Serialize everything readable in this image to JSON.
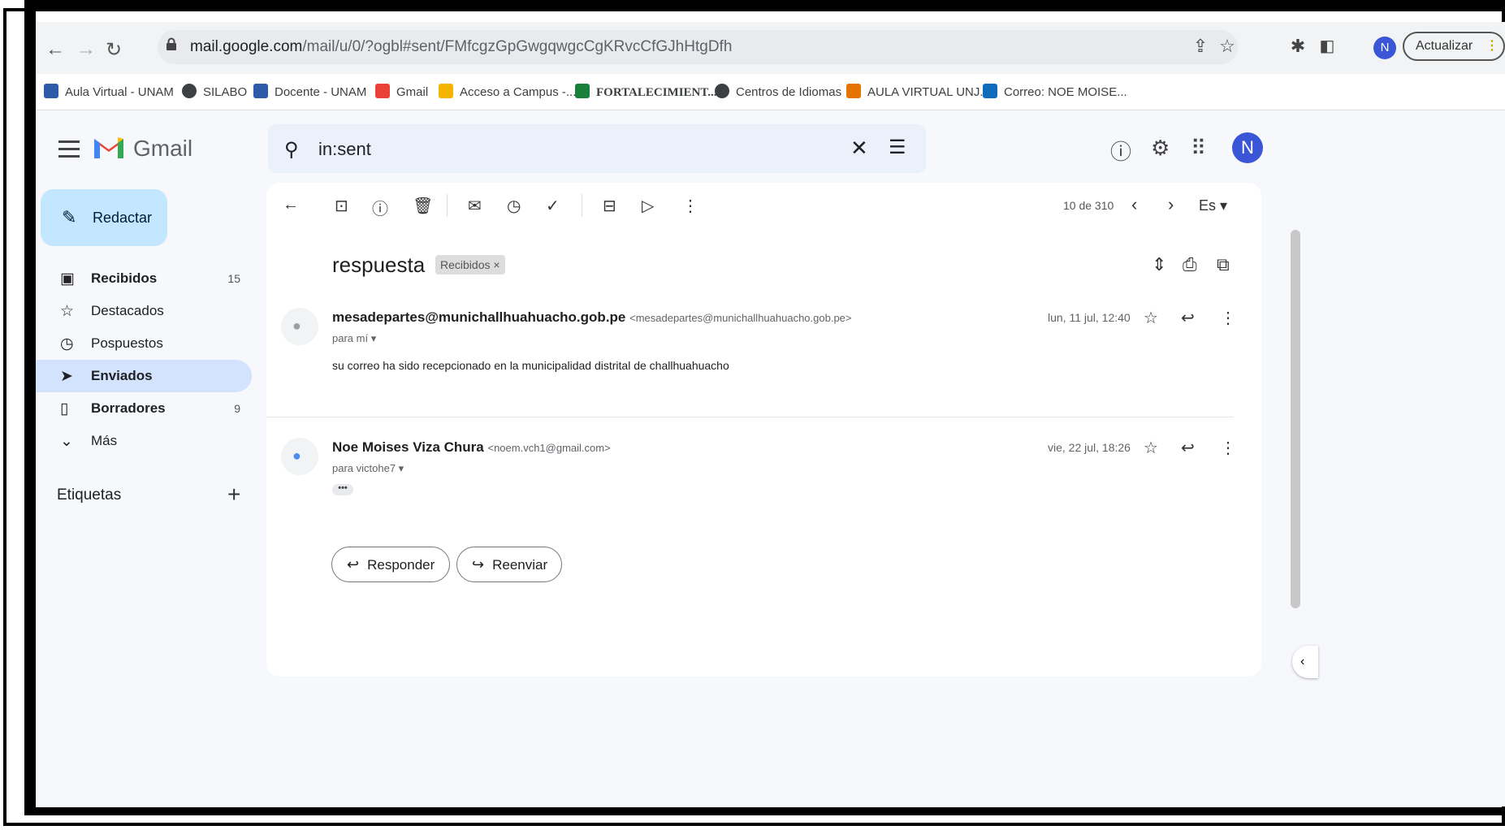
{
  "browser": {
    "url_host": "mail.google.com",
    "url_path": "/mail/u/0/?ogbl#sent/FMfcgzGpGwgqwgcCgKRvcCfGJhHtgDfh",
    "update_label": "Actualizar",
    "profile_initial": "N"
  },
  "bookmarks": [
    {
      "label": "Aula Virtual - UNAM",
      "color": "#2e5aa8"
    },
    {
      "label": "SILABO",
      "color": "#3c4043"
    },
    {
      "label": "Docente - UNAM",
      "color": "#2e5aa8"
    },
    {
      "label": "Gmail",
      "color": "#ea4335"
    },
    {
      "label": "Acceso a Campus -...",
      "color": "#f4b400"
    },
    {
      "label": "FORTALECIMIENT...",
      "color": "#188038"
    },
    {
      "label": "Centros de Idiomas",
      "color": "#3c4043"
    },
    {
      "label": "AULA VIRTUAL UNJ...",
      "color": "#e37400"
    },
    {
      "label": "Correo: NOE MOISE...",
      "color": "#0f6cbd"
    }
  ],
  "gmail": {
    "logo_text": "Gmail",
    "search_query": "in:sent",
    "avatar_initial": "N"
  },
  "sidebar": {
    "compose_label": "Redactar",
    "items": [
      {
        "label": "Recibidos",
        "count": "15",
        "icon": "inbox-icon"
      },
      {
        "label": "Destacados",
        "count": "",
        "icon": "star-icon"
      },
      {
        "label": "Pospuestos",
        "count": "",
        "icon": "clock-icon"
      },
      {
        "label": "Enviados",
        "count": "",
        "icon": "send-icon"
      },
      {
        "label": "Borradores",
        "count": "9",
        "icon": "draft-icon"
      },
      {
        "label": "Más",
        "count": "",
        "icon": "chevron-down-icon"
      }
    ],
    "labels_title": "Etiquetas"
  },
  "toolbar": {
    "pager": "10 de 310",
    "lang": "Es"
  },
  "thread": {
    "subject": "respuesta",
    "label_chip": "Recibidos ×",
    "messages": [
      {
        "sender_name": "mesadepartes@munichallhuahuacho.gob.pe",
        "sender_email": "<mesadepartes@munichallhuahuacho.gob.pe>",
        "to": "para mí",
        "date": "lun, 11 jul, 12:40",
        "body": "su correo ha sido recepcionado en la municipalidad distrital de challhuahuacho"
      },
      {
        "sender_name": "Noe Moises Viza Chura",
        "sender_email": "<noem.vch1@gmail.com>",
        "to": "para victohe7",
        "date": "vie, 22 jul, 18:26",
        "body": "•••"
      }
    ],
    "reply_label": "Responder",
    "forward_label": "Reenviar"
  }
}
